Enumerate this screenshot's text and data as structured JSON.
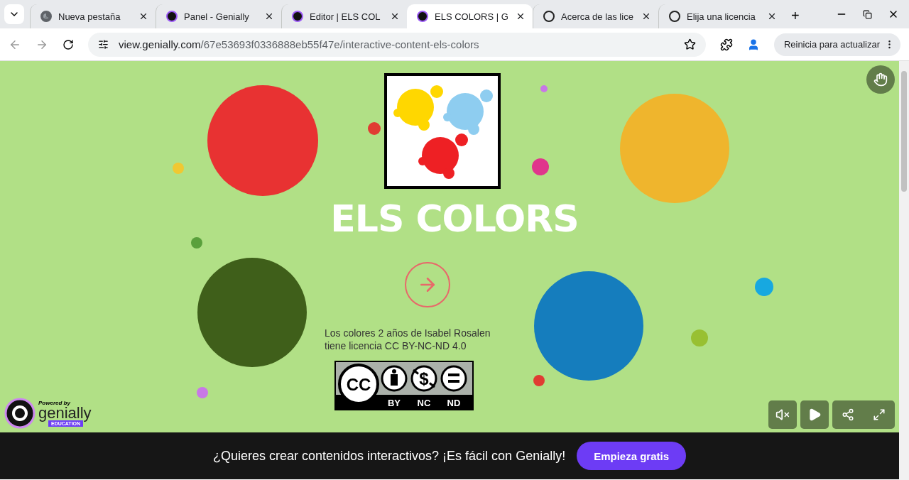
{
  "tabs": [
    {
      "title": "Nueva pestaña",
      "kind": "chrome",
      "selected": false
    },
    {
      "title": "Panel - Genially",
      "kind": "genially",
      "selected": false
    },
    {
      "title": "Editor | ELS COL",
      "kind": "genially",
      "selected": false
    },
    {
      "title": "ELS COLORS | G",
      "kind": "genially",
      "selected": true
    },
    {
      "title": "Acerca de las lice",
      "kind": "cc",
      "selected": false
    },
    {
      "title": "Elija una licencia",
      "kind": "cc",
      "selected": false
    }
  ],
  "new_tab": "+",
  "address": {
    "domain": "view.genially.com",
    "path": "/67e53693f0336888eb55f47e/interactive-content-els-colors"
  },
  "update_button": "Reinicia para actualizar",
  "slide": {
    "title": "ELS COLORS",
    "circles": [
      {
        "color": "#e83232"
      },
      {
        "color": "#f0c832"
      },
      {
        "color": "#e03c32"
      },
      {
        "color": "#c878e6"
      },
      {
        "color": "#e0368c"
      },
      {
        "color": "#efb52d"
      },
      {
        "color": "#5aa03c"
      },
      {
        "color": "#3f5f1a"
      },
      {
        "color": "#157dbd"
      },
      {
        "color": "#17a8e0"
      },
      {
        "color": "#98c032"
      },
      {
        "color": "#e03c32"
      },
      {
        "color": "#c878e6"
      }
    ],
    "attribution": "Los colores 2 años de Isabel Rosalen\ntiene licencia CC BY-NC-ND 4.0",
    "license": {
      "cc": "CC",
      "dollar": "$",
      "terms": [
        "BY",
        "NC",
        "ND"
      ]
    }
  },
  "powered": {
    "by": "Powered by",
    "brand": "genially",
    "tier": "EDUCATION"
  },
  "banner": {
    "text": "¿Quieres crear contenidos interactivos? ¡Es fácil con Genially!",
    "button": "Empieza gratis"
  }
}
